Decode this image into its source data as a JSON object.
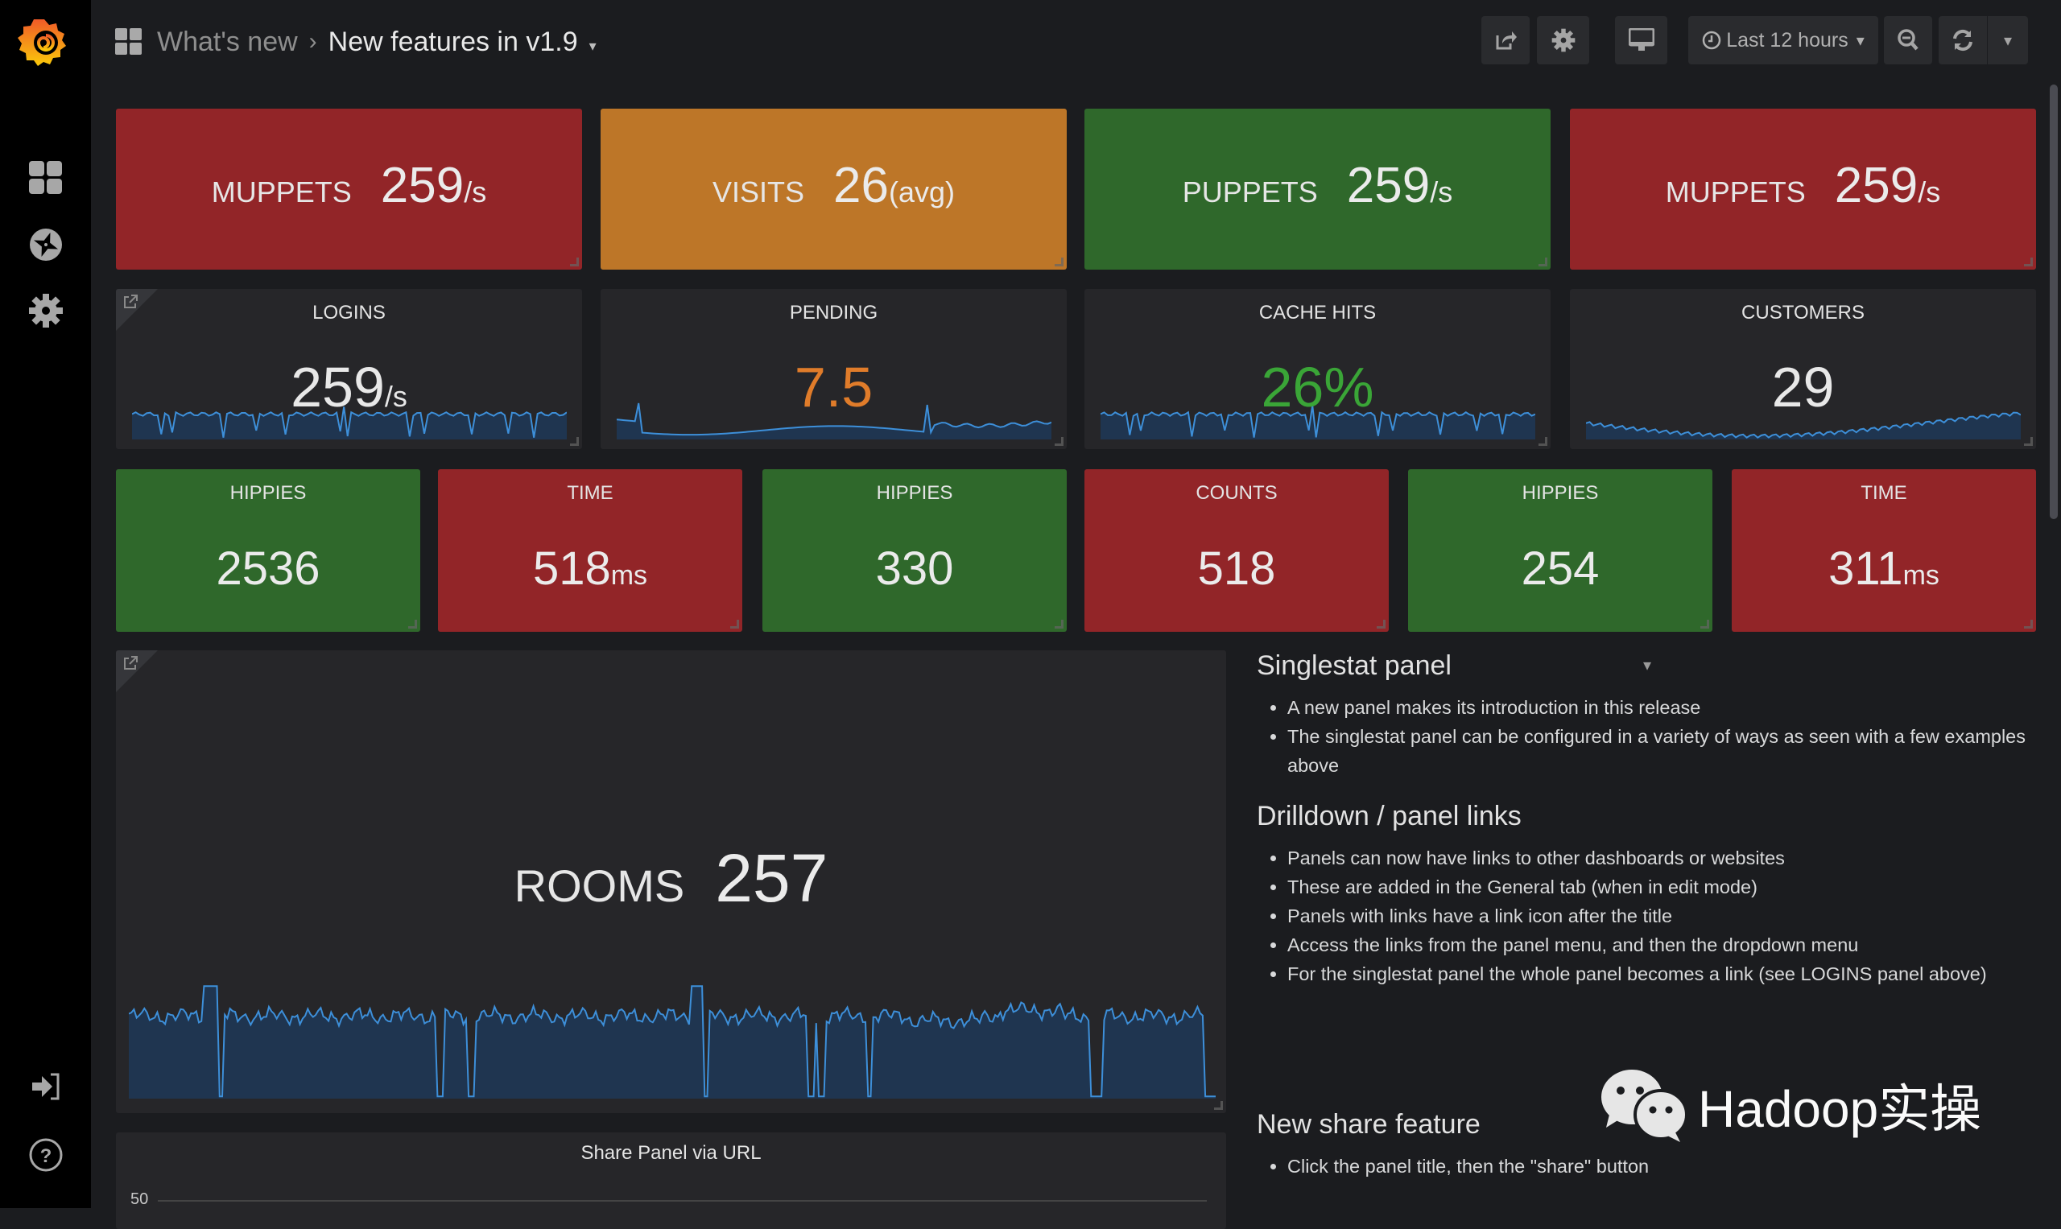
{
  "sidebar": {
    "items": [
      {
        "name": "dashboards",
        "icon": "dashboards-grid-icon"
      },
      {
        "name": "explore",
        "icon": "compass-icon"
      },
      {
        "name": "configuration",
        "icon": "gear-icon"
      }
    ],
    "bottom": [
      {
        "name": "sign-in",
        "icon": "sign-in-icon"
      },
      {
        "name": "help",
        "icon": "help-icon"
      }
    ]
  },
  "header": {
    "breadcrumb_parent": "What's new",
    "breadcrumb_separator": "›",
    "title": "New features in v1.9",
    "caret": "▾",
    "time_range": "Last 12 hours",
    "time_caret": "▾",
    "refresh_caret": "▾"
  },
  "row1": [
    {
      "label": "MUPPETS",
      "value": "259",
      "unit": "/s",
      "color": "#922528"
    },
    {
      "label": "VISITS",
      "value": "26",
      "unit": " (avg)",
      "color": "#bd7628"
    },
    {
      "label": "PUPPETS",
      "value": "259",
      "unit": "/s",
      "color": "#2f682b"
    },
    {
      "label": "MUPPETS",
      "value": "259",
      "unit": "/s",
      "color": "#922528"
    }
  ],
  "row2": [
    {
      "title": "LOGINS",
      "value": "259",
      "unit": "/s",
      "value_color": "#e8e8e8",
      "has_link": true
    },
    {
      "title": "PENDING",
      "value": "7.5",
      "unit": "",
      "value_color": "#e07c2a",
      "has_link": false
    },
    {
      "title": "CACHE HITS",
      "value": "26%",
      "unit": "",
      "value_color": "#3aa537",
      "has_link": false
    },
    {
      "title": "CUSTOMERS",
      "value": "29",
      "unit": "",
      "value_color": "#e8e8e8",
      "has_link": false
    }
  ],
  "row3": [
    {
      "title": "HIPPIES",
      "value": "2536",
      "unit": "",
      "color": "#2f682b"
    },
    {
      "title": "TIME",
      "value": "518",
      "unit": "ms",
      "color": "#922528"
    },
    {
      "title": "HIPPIES",
      "value": "330",
      "unit": "",
      "color": "#2f682b"
    },
    {
      "title": "COUNTS",
      "value": "518",
      "unit": "",
      "color": "#922528"
    },
    {
      "title": "HIPPIES",
      "value": "254",
      "unit": "",
      "color": "#2f682b"
    },
    {
      "title": "TIME",
      "value": "311",
      "unit": "ms",
      "color": "#922528"
    }
  ],
  "rooms": {
    "label": "ROOMS",
    "value": "257"
  },
  "share_panel": {
    "title": "Share Panel via URL",
    "y_tick": "50"
  },
  "text_panel": {
    "sections": [
      {
        "heading": "Singlestat panel",
        "items": [
          "A new panel makes its introduction in this release",
          "The singlestat panel can be configured in a variety of ways as seen with a few examples above"
        ]
      },
      {
        "heading": "Drilldown / panel links",
        "items": [
          "Panels can now have links to other dashboards or websites",
          "These are added in the General tab (when in edit mode)",
          "Panels with links have a link icon after the title",
          "Access the links from the panel menu, and then the dropdown menu",
          "For the singlestat panel the whole panel becomes a link (see LOGINS panel above)"
        ]
      },
      {
        "heading": "New share feature",
        "items": [
          "Click the panel title, then the \"share\" button"
        ]
      }
    ],
    "menu_caret": "▾"
  },
  "watermark": {
    "text": "Hadoop实操"
  },
  "colors": {
    "sparkline": "#3d8fd9",
    "spark_fill": "#1f3550"
  }
}
